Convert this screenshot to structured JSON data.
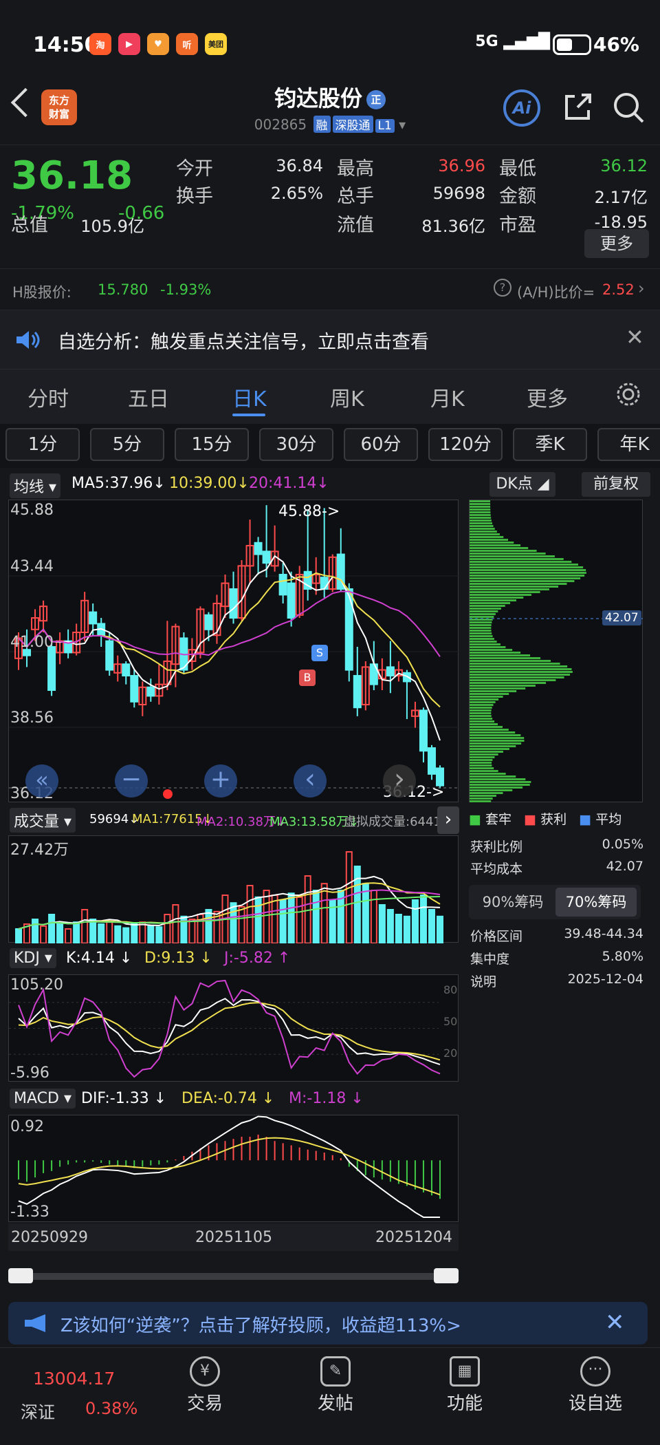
{
  "status": {
    "time": "14:50",
    "network": "5G",
    "battery": "46%",
    "apps": [
      "淘",
      "▶",
      "♥",
      "听",
      "美团"
    ]
  },
  "header": {
    "title": "钧达股份",
    "badge": "正",
    "code": "002865",
    "tags": [
      "融",
      "深股通",
      "L1"
    ],
    "logo": "东方\n财富",
    "ai": "Ai"
  },
  "quote": {
    "price": "36.18",
    "pct": "-1.79%",
    "chg": "-0.66",
    "r1": [
      {
        "l": "今开",
        "v": "36.84",
        "c": "#e8e8e8"
      },
      {
        "l": "最高",
        "v": "36.96",
        "c": "#ff4b4b"
      },
      {
        "l": "最低",
        "v": "36.12",
        "c": "#3fc945"
      }
    ],
    "r2": [
      {
        "l": "换手",
        "v": "2.65%",
        "c": "#e8e8e8"
      },
      {
        "l": "总手",
        "v": "59698",
        "c": "#e8e8e8"
      },
      {
        "l": "金额",
        "v": "2.17亿",
        "c": "#e8e8e8"
      }
    ],
    "r3": [
      {
        "l": "总值",
        "v": "105.9亿",
        "c": "#e8e8e8"
      },
      {
        "l": "流值",
        "v": "81.36亿",
        "c": "#e8e8e8"
      },
      {
        "l": "市盈",
        "v": "-18.95",
        "c": "#e8e8e8"
      }
    ],
    "more": "更多"
  },
  "hshare": {
    "label": "H股报价:",
    "price": "15.780",
    "pct": "-1.93%",
    "ratio_label": "(A/H)比价=",
    "ratio": "2.52"
  },
  "notice": {
    "text": "自选分析：触发重点关注信号，立即点击查看"
  },
  "tabs": [
    "分时",
    "五日",
    "日K",
    "周K",
    "月K",
    "更多"
  ],
  "periods": [
    "1分",
    "5分",
    "15分",
    "30分",
    "60分",
    "120分",
    "季K",
    "年K"
  ],
  "ma": {
    "sel": "均线",
    "ma5": "MA5:37.96",
    "ma10": "10:39.00",
    "ma20": "20:41.14"
  },
  "kline": {
    "y": [
      "45.88",
      "43.44",
      "41.00",
      "38.56",
      "36.12"
    ],
    "hi_label": "45.88->",
    "lo_label": "36.12->",
    "cost": "42.07",
    "candles": [
      [
        40.6,
        41.3,
        40.2,
        41.5
      ],
      [
        40.9,
        40.7,
        40.3,
        41.6
      ],
      [
        41.6,
        42.0,
        41.2,
        42.3
      ],
      [
        41.9,
        42.4,
        41.5,
        42.6
      ],
      [
        41.0,
        39.5,
        39.3,
        41.1
      ],
      [
        40.8,
        41.2,
        40.4,
        41.5
      ],
      [
        41.2,
        40.8,
        40.6,
        41.6
      ],
      [
        40.8,
        41.5,
        40.7,
        41.8
      ],
      [
        41.5,
        42.6,
        41.2,
        42.9
      ],
      [
        42.2,
        41.8,
        41.4,
        42.5
      ],
      [
        41.8,
        41.4,
        41.0,
        42.0
      ],
      [
        41.2,
        40.2,
        40.0,
        41.5
      ],
      [
        40.1,
        40.4,
        39.8,
        40.7
      ],
      [
        40.4,
        40.0,
        39.7,
        40.5
      ],
      [
        40.0,
        39.1,
        38.9,
        40.2
      ],
      [
        39.0,
        39.6,
        38.6,
        39.8
      ],
      [
        39.6,
        39.3,
        39.1,
        39.9
      ],
      [
        39.3,
        39.7,
        39.0,
        40.4
      ],
      [
        39.7,
        40.5,
        39.5,
        41.9
      ],
      [
        40.4,
        41.7,
        39.6,
        41.8
      ],
      [
        41.3,
        40.2,
        40.1,
        41.5
      ],
      [
        40.5,
        40.9,
        40.2,
        41.3
      ],
      [
        40.8,
        42.3,
        40.6,
        42.4
      ],
      [
        42.1,
        41.6,
        41.2,
        42.2
      ],
      [
        41.4,
        42.5,
        41.1,
        42.8
      ],
      [
        42.4,
        43.2,
        42.0,
        43.5
      ],
      [
        43.0,
        42.0,
        41.8,
        43.6
      ],
      [
        42.0,
        43.8,
        41.9,
        44.0
      ],
      [
        43.8,
        44.5,
        43.2,
        45.4
      ],
      [
        44.6,
        44.2,
        43.5,
        44.8
      ],
      [
        44.3,
        43.9,
        43.4,
        45.9
      ],
      [
        43.8,
        44.3,
        43.6,
        45.2
      ],
      [
        43.5,
        42.8,
        42.5,
        43.9
      ],
      [
        43.2,
        42.0,
        41.7,
        43.6
      ],
      [
        42.1,
        43.5,
        42.0,
        43.8
      ],
      [
        43.6,
        43.0,
        42.6,
        45.7
      ],
      [
        43.2,
        43.5,
        42.8,
        44.1
      ],
      [
        43.4,
        43.0,
        42.7,
        45.8
      ],
      [
        43.0,
        44.1,
        42.9,
        44.2
      ],
      [
        44.2,
        43.0,
        42.9,
        45.1
      ],
      [
        43.0,
        40.2,
        39.8,
        43.2
      ],
      [
        40.0,
        38.9,
        38.6,
        41.0
      ],
      [
        39.0,
        40.3,
        38.8,
        40.5
      ],
      [
        40.4,
        39.7,
        39.5,
        41.2
      ],
      [
        39.9,
        40.2,
        39.5,
        40.6
      ],
      [
        40.3,
        40.0,
        39.4,
        41.2
      ],
      [
        40.0,
        40.2,
        39.8,
        40.5
      ],
      [
        40.1,
        39.8,
        38.5,
        40.2
      ],
      [
        38.6,
        38.8,
        38.2,
        39.1
      ],
      [
        38.8,
        37.4,
        37.0,
        38.9
      ],
      [
        37.5,
        36.6,
        36.4,
        37.6
      ],
      [
        36.8,
        36.2,
        36.1,
        36.9
      ]
    ]
  },
  "ma_lines": {
    "ma5": "MA5",
    "ma10": "MA10",
    "ma20": "MA20"
  },
  "nav": {
    "minus": "−",
    "plus": "+",
    "left": "‹",
    "right": "›",
    "fast": "«"
  },
  "vol": {
    "sel": "成交量",
    "v": "59694↓",
    "ma1": "MA1:77615↓",
    "ma2": "MA2:10.38万↓",
    "ma3": "MA3:13.58万↓",
    "virt": "虚拟成交量:64410",
    "ymax": "27.42万",
    "bars": [
      0.15,
      0.2,
      0.25,
      0.18,
      0.3,
      0.2,
      0.15,
      0.22,
      0.35,
      0.25,
      0.2,
      0.22,
      0.18,
      0.16,
      0.2,
      0.22,
      0.18,
      0.17,
      0.3,
      0.4,
      0.28,
      0.25,
      0.3,
      0.35,
      0.33,
      0.5,
      0.42,
      0.38,
      0.6,
      0.48,
      0.55,
      0.5,
      0.45,
      0.52,
      0.48,
      0.7,
      0.55,
      0.62,
      0.45,
      0.55,
      0.95,
      0.8,
      0.62,
      0.55,
      0.4,
      0.35,
      0.3,
      0.28,
      0.45,
      0.5,
      0.35,
      0.28
    ],
    "colors": [
      "c",
      "r",
      "c",
      "r",
      "c",
      "c",
      "r",
      "c",
      "r",
      "c",
      "c",
      "r",
      "c",
      "c",
      "c",
      "r",
      "c",
      "c",
      "r",
      "r",
      "c",
      "r",
      "r",
      "c",
      "r",
      "r",
      "c",
      "r",
      "r",
      "c",
      "r",
      "r",
      "c",
      "c",
      "r",
      "r",
      "c",
      "r",
      "c",
      "c",
      "r",
      "c",
      "c",
      "r",
      "c",
      "c",
      "c",
      "c",
      "c",
      "c",
      "c",
      "c"
    ]
  },
  "kdj": {
    "sel": "KDJ",
    "k": "K:4.14",
    "d": "D:9.13",
    "j": "J:-5.82",
    "ymax": "105.20",
    "ymin": "-5.96",
    "lv": [
      "80",
      "50",
      "20"
    ]
  },
  "macd": {
    "sel": "MACD",
    "dif": "DIF:-1.33",
    "dea": "DEA:-0.74",
    "m": "M:-1.18",
    "ymax": "0.92",
    "ymin": "-1.33",
    "hist": [
      -0.45,
      -0.5,
      -0.4,
      -0.3,
      -0.25,
      -0.15,
      -0.1,
      -0.05,
      -0.05,
      -0.03,
      -0.06,
      -0.1,
      -0.12,
      -0.15,
      -0.18,
      -0.15,
      -0.12,
      -0.1,
      -0.05,
      0.02,
      0.1,
      0.2,
      0.28,
      0.35,
      0.4,
      0.45,
      0.5,
      0.55,
      0.55,
      0.6,
      0.55,
      0.45,
      0.4,
      0.35,
      0.3,
      0.25,
      0.22,
      0.18,
      0.12,
      0.05,
      -0.15,
      -0.25,
      -0.35,
      -0.4,
      -0.45,
      -0.5,
      -0.55,
      -0.6,
      -0.68,
      -0.75,
      -0.82,
      -0.9
    ]
  },
  "dates": [
    "20250929",
    "20251105",
    "20251204"
  ],
  "side": {
    "dk": "DK点",
    "fq": "前复权",
    "legend": [
      "套牢",
      "获利",
      "平均"
    ],
    "rows": [
      {
        "l": "获利比例",
        "v": "0.05%"
      },
      {
        "l": "平均成本",
        "v": "42.07"
      }
    ],
    "btn90": "90%筹码",
    "btn70": "70%筹码",
    "rows2": [
      {
        "l": "价格区间",
        "v": "39.48-44.34"
      },
      {
        "l": "集中度",
        "v": "5.80%"
      },
      {
        "l": "说明",
        "v": "2025-12-04"
      }
    ]
  },
  "ad": {
    "text": "Z该如何“逆袭”？点击了解好投顾，收益超113%>"
  },
  "bottom": {
    "index": "13004.17",
    "name": "深证",
    "pct": "0.38%",
    "items": [
      "交易",
      "发帖",
      "功能",
      "设自选"
    ]
  },
  "colors": {
    "up": "#ff4b4b",
    "down": "#3fc945",
    "cyan": "#5ff0f2",
    "ma5": "#ffffff",
    "ma10": "#f0e050",
    "ma20": "#d040d0"
  }
}
